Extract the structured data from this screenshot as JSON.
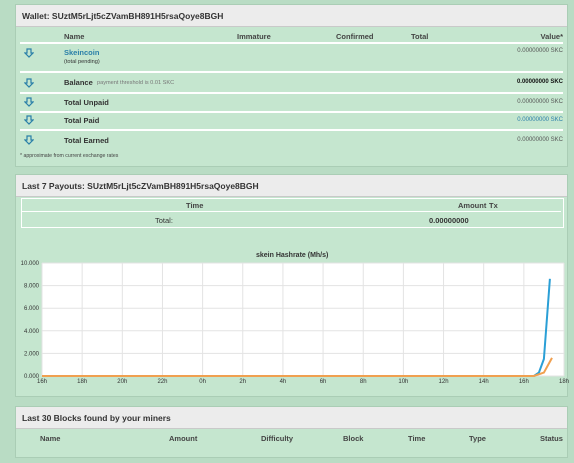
{
  "wallet": {
    "title": "Wallet: SUztM5rLjt5cZVamBH891H5rsaQoye8BGH",
    "columns": [
      "Name",
      "Immature",
      "Confirmed",
      "Total",
      "Value*"
    ],
    "coin": {
      "name": "Skeincoin",
      "note": "(total pending)",
      "value": "0.00000000 SKC"
    },
    "balance": {
      "label": "Balance",
      "note": "payment threshold is 0.01 SKC",
      "value": "0.00000000 SKC"
    },
    "unpaid": {
      "label": "Total Unpaid",
      "value": "0.00000000 SKC"
    },
    "paid": {
      "label": "Total Paid",
      "value": "0.00000000 SKC"
    },
    "earned": {
      "label": "Total Earned",
      "value": "0.00000000 SKC"
    },
    "footnote": "* approximate from current exchange rates"
  },
  "payouts": {
    "title": "Last 7 Payouts: SUztM5rLjt5cZVamBH891H5rsaQoye8BGH",
    "columns": [
      "Time",
      "Amount",
      "Tx"
    ],
    "total_label": "Total:",
    "total_value": "0.00000000"
  },
  "chart_data": {
    "type": "line",
    "title": "skein Hashrate (Mh/s)",
    "ylim": [
      0,
      10
    ],
    "yticks": [
      "0.000",
      "2.000",
      "4.000",
      "6.000",
      "8.000",
      "10.000"
    ],
    "xticks": [
      "16h",
      "18h",
      "20h",
      "22h",
      "0h",
      "2h",
      "4h",
      "6h",
      "8h",
      "10h",
      "12h",
      "14h",
      "16h",
      "18h"
    ],
    "x_hours_ticks": [
      0,
      2,
      4,
      6,
      8,
      10,
      12,
      14,
      16,
      18,
      20,
      22,
      24,
      26
    ],
    "series": [
      {
        "color": "#2a9fd6",
        "points": [
          [
            0,
            0
          ],
          [
            24.5,
            0
          ],
          [
            24.75,
            0.3
          ],
          [
            25.0,
            1.5
          ],
          [
            25.3,
            8.6
          ]
        ]
      },
      {
        "color": "#f0a050",
        "points": [
          [
            0,
            0
          ],
          [
            24.5,
            0
          ],
          [
            25.0,
            0.3
          ],
          [
            25.4,
            1.6
          ]
        ]
      }
    ],
    "grid": true
  },
  "blocks": {
    "title": "Last 30 Blocks found by your miners",
    "columns": [
      "Name",
      "Amount",
      "Difficulty",
      "Block",
      "Time",
      "Type",
      "Status"
    ]
  },
  "colors": {
    "link": "#2a7fa8",
    "panel": "#c5e6cf"
  }
}
